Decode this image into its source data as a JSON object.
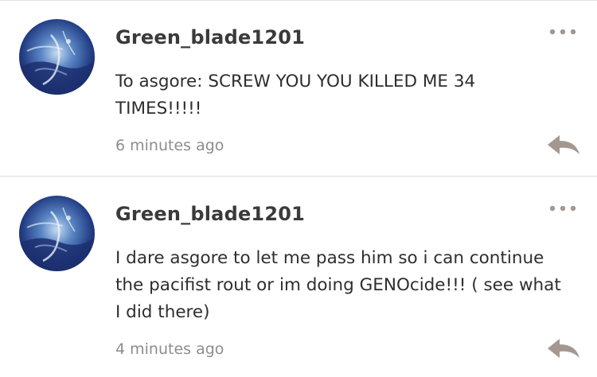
{
  "comments": [
    {
      "username": "Green_blade1201",
      "text": "To asgore: SCREW YOU YOU KILLED ME 34 TIMES!!!!!",
      "timestamp": "6 minutes ago",
      "more_icon": "more-dots-icon",
      "reply_icon": "reply-arrow-icon"
    },
    {
      "username": "Green_blade1201",
      "text": "I dare asgore to let me pass him so i can continue the pacifist rout or im doing GENOcide!!! ( see what I did there)",
      "timestamp": "4 minutes ago",
      "more_icon": "more-dots-icon",
      "reply_icon": "reply-arrow-icon"
    }
  ],
  "colors": {
    "username": "#3a3a3a",
    "text": "#2e2e2e",
    "timestamp": "#8d8d8d",
    "icon": "#a39890",
    "divider": "#dcdcdc"
  }
}
